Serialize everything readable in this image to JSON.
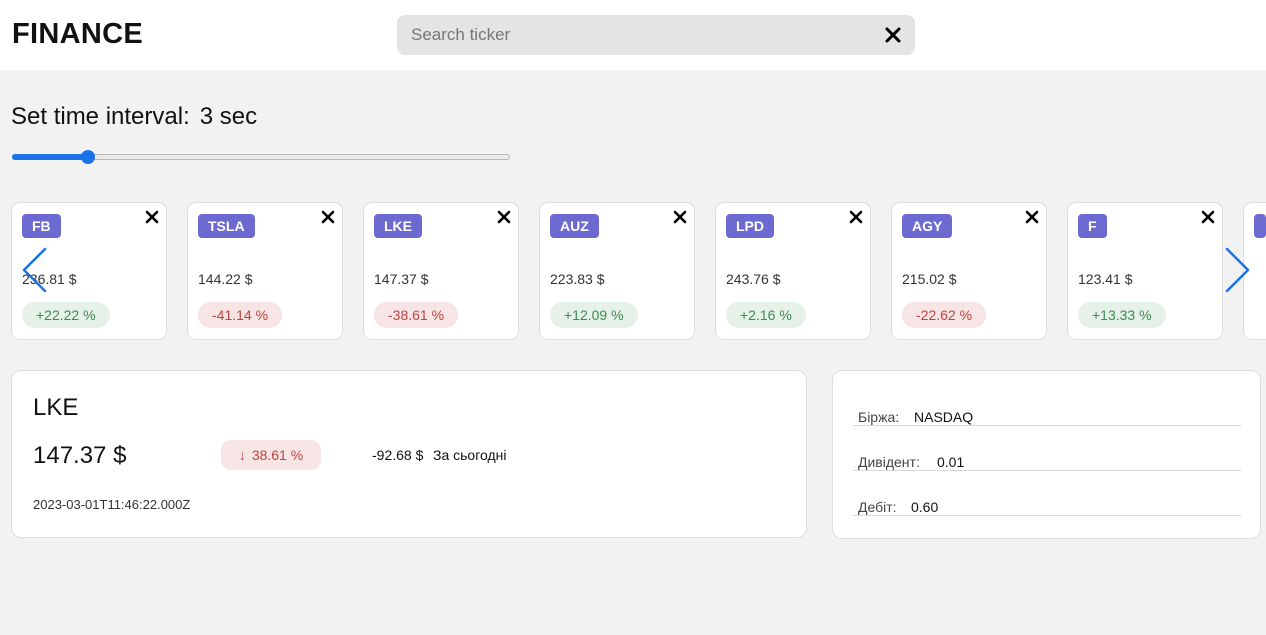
{
  "header": {
    "logo": "FINANCE",
    "search_placeholder": "Search ticker",
    "search_value": ""
  },
  "interval": {
    "label": "Set time interval:",
    "value": "3 sec",
    "slider_fraction": 0.15
  },
  "colors": {
    "accent": "#1a73e8",
    "tag": "#6c6ad0",
    "positive": "#3d8a52",
    "negative": "#c0433f"
  },
  "tickers": [
    {
      "symbol": "FB",
      "price": "236.81 $",
      "change": "+22.22 %",
      "direction": "up"
    },
    {
      "symbol": "TSLA",
      "price": "144.22 $",
      "change": "-41.14 %",
      "direction": "down"
    },
    {
      "symbol": "LKE",
      "price": "147.37 $",
      "change": "-38.61 %",
      "direction": "down"
    },
    {
      "symbol": "AUZ",
      "price": "223.83 $",
      "change": "+12.09 %",
      "direction": "up"
    },
    {
      "symbol": "LPD",
      "price": "243.76 $",
      "change": "+2.16 %",
      "direction": "up"
    },
    {
      "symbol": "AGY",
      "price": "215.02 $",
      "change": "-22.62 %",
      "direction": "down"
    },
    {
      "symbol": "F",
      "price": "123.41 $",
      "change": "+13.33 %",
      "direction": "up"
    }
  ],
  "detail": {
    "ticker": "LKE",
    "price": "147.37 $",
    "change": "38.61 %",
    "change_arrow": "↓",
    "delta": "-92.68 $",
    "period": "За сьогодні",
    "timestamp": "2023-03-01T11:46:22.000Z"
  },
  "info": {
    "rows": [
      {
        "label": "Біржа:",
        "value": "NASDAQ"
      },
      {
        "label": "Дивідент:",
        "value": "0.01"
      },
      {
        "label": "Дебіт:",
        "value": "0.60"
      }
    ]
  }
}
